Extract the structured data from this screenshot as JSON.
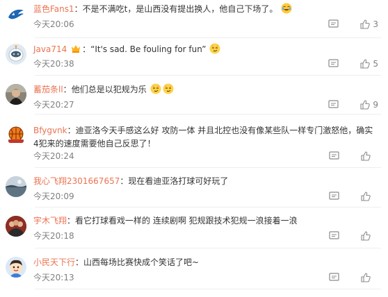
{
  "comments": [
    {
      "user": "蓝色Fans1",
      "text": "不是不满吃t，是山西没有提出换人，他自己下场了。",
      "emoji": [
        "laugh-cry-icon"
      ],
      "time": "今天20:06",
      "likes": "3",
      "avatar_icon": "shark-logo-avatar"
    },
    {
      "user": "Java714",
      "text": "“It's sad. Be fouling for fun”",
      "emoji": [
        "smirk-icon"
      ],
      "time": "今天20:38",
      "likes": "5",
      "avatar_icon": "bot-avatar"
    },
    {
      "user": "蓄茄条ll",
      "text": "他们总是以犯规为乐",
      "emoji": [
        "smirk-icon",
        "smirk-icon"
      ],
      "time": "今天20:27",
      "likes": "9",
      "avatar_icon": "person-avatar"
    },
    {
      "user": "Bfygvnk",
      "text": "迪亚洛今天手感这么好 攻防一体 并且北控也没有像某些队一样专门激怒他，确实4犯来的速度需要他自己反思了！",
      "time": "今天20:24",
      "likes": "",
      "avatar_icon": "basketball-logo-avatar"
    },
    {
      "user": "我心飞翔2301667657",
      "text": "现在看迪亚洛打球可好玩了",
      "time": "今天20:09",
      "likes": "",
      "avatar_icon": "seascape-avatar"
    },
    {
      "user": "宇木飞翔",
      "text": "看它打球看戏一样的 连续剧啊 犯规跟技术犯规一浪接着一浪",
      "time": "今天20:18",
      "likes": "",
      "avatar_icon": "group-photo-avatar"
    },
    {
      "user": "小民天下行",
      "text": "山西每场比赛快成个笑话了吧~",
      "time": "今天20:13",
      "likes": "",
      "avatar_icon": "cartoon-boy-avatar"
    }
  ],
  "separator": "：",
  "colors": {
    "username": "#eb7350",
    "text": "#333333",
    "meta": "#808080",
    "divider": "#eeeeee"
  }
}
